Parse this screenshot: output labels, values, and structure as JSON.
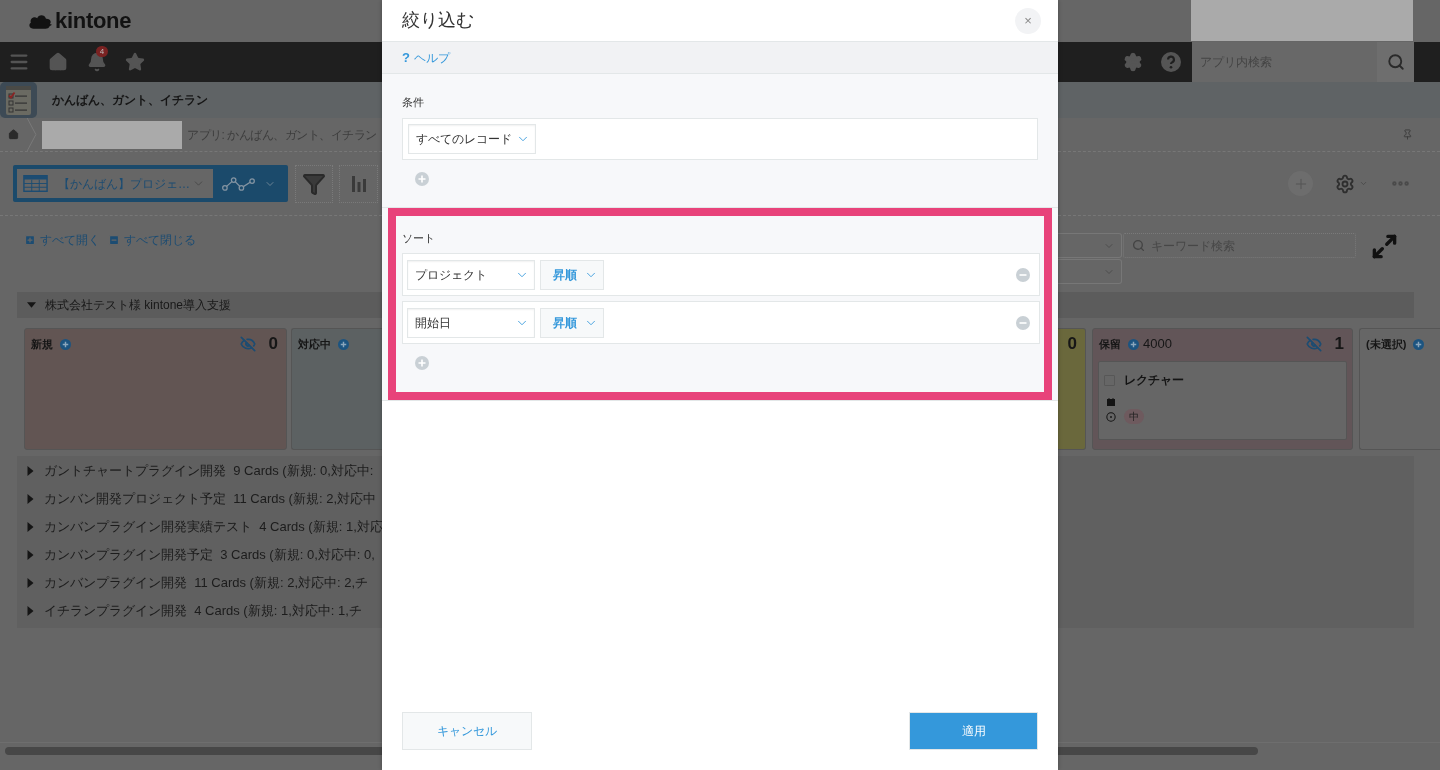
{
  "header": {
    "logo": "kintone",
    "notification_count": "4",
    "app_search": {
      "placeholder": "アプリ内検索"
    }
  },
  "app": {
    "title": "かんばん、ガント、イチラン",
    "breadcrumb": "アプリ: かんばん、ガント、イチラン"
  },
  "toolbar": {
    "view": "【かんばん】プロジェ…"
  },
  "board": {
    "expand_all": "すべて開く",
    "collapse_all": "すべて閉じる",
    "keyword_search": {
      "placeholder": "キーワード検索"
    },
    "groups": [
      {
        "title": "株式会社テスト様 kintone導入支援",
        "expanded": true,
        "columns": [
          {
            "name": "新規",
            "count": "0",
            "color": "#625553"
          },
          {
            "name": "対応中",
            "color": "#5c6162"
          },
          {
            "count": "0",
            "color": "#6a683c"
          },
          {
            "name": "保留",
            "amount": "4000",
            "count": "1",
            "color": "#625558",
            "cards": [
              {
                "title": "レクチャー",
                "checked": false,
                "tag": "中"
              }
            ]
          },
          {
            "name": "(未選択)",
            "color": "#666666"
          }
        ]
      },
      {
        "title": "ガントチャートプラグイン開発  9 Cards (新規: 0,対応中:",
        "expanded": false
      },
      {
        "title": "カンバン開発プロジェクト予定  11 Cards (新規: 2,対応中",
        "expanded": false
      },
      {
        "title": "カンバンプラグイン開発実績テスト  4 Cards (新規: 1,対応",
        "expanded": false
      },
      {
        "title": "カンバンプラグイン開発予定  3 Cards (新規: 0,対応中: 0,",
        "expanded": false
      },
      {
        "title": "カンバンプラグイン開発  11 Cards (新規: 2,対応中: 2,チ",
        "expanded": false
      },
      {
        "title": "イチランプラグイン開発  4 Cards (新規: 1,対応中: 1,チ",
        "expanded": false
      }
    ]
  },
  "dialog": {
    "title": "絞り込む",
    "close": "×",
    "help": {
      "icon": "?",
      "label": "ヘルプ"
    },
    "conditions": {
      "label": "条件",
      "rules": [
        {
          "field": "すべてのレコード"
        }
      ]
    },
    "sort": {
      "label": "ソート",
      "highlighted": true,
      "rules": [
        {
          "field": "プロジェクト",
          "order": "昇順"
        },
        {
          "field": "開始日",
          "order": "昇順"
        }
      ]
    },
    "buttons": [
      {
        "label": "キャンセル",
        "kind": "secondary"
      },
      {
        "label": "適用",
        "kind": "primary"
      }
    ]
  }
}
